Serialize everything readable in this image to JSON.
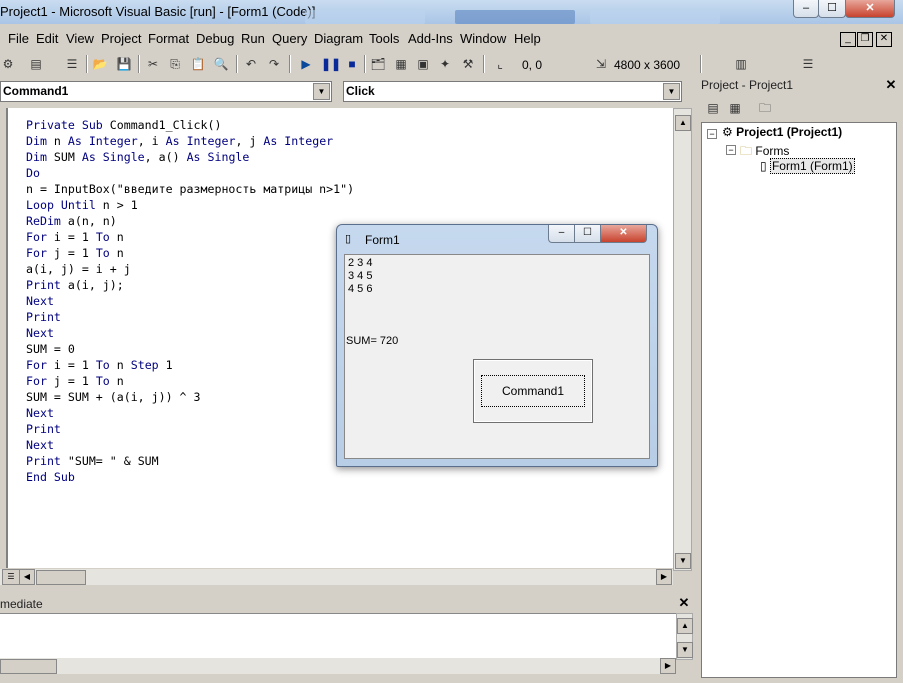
{
  "window": {
    "title": "Project1 - Microsoft Visual Basic [run] - [Form1 (Code)]",
    "controls": {
      "minimize": "–",
      "maximize": "☐",
      "close": "✕"
    }
  },
  "menu": {
    "items": [
      "File",
      "Edit",
      "View",
      "Project",
      "Format",
      "Debug",
      "Run",
      "Query",
      "Diagram",
      "Tools",
      "Add-Ins",
      "Window",
      "Help"
    ],
    "mdi": {
      "minimize": "_",
      "restore": "❐",
      "close": "✕"
    }
  },
  "toolbar": {
    "position": "0, 0",
    "size": "4800 x 3600"
  },
  "code_window": {
    "object_combo": "Command1",
    "procedure_combo": "Click",
    "lines": [
      [
        {
          "k": true,
          "t": "Private Sub "
        },
        {
          "k": false,
          "t": "Command1_Click()"
        }
      ],
      [
        {
          "k": true,
          "t": "Dim "
        },
        {
          "k": false,
          "t": "n "
        },
        {
          "k": true,
          "t": "As Integer"
        },
        {
          "k": false,
          "t": ", i "
        },
        {
          "k": true,
          "t": "As Integer"
        },
        {
          "k": false,
          "t": ", j "
        },
        {
          "k": true,
          "t": "As Integer"
        }
      ],
      [
        {
          "k": true,
          "t": "Dim "
        },
        {
          "k": false,
          "t": "SUM "
        },
        {
          "k": true,
          "t": "As Single"
        },
        {
          "k": false,
          "t": ", a() "
        },
        {
          "k": true,
          "t": "As Single"
        }
      ],
      [
        {
          "k": true,
          "t": "Do"
        }
      ],
      [
        {
          "k": false,
          "t": "n = InputBox(\"введите размерность матрицы n>1\")"
        }
      ],
      [
        {
          "k": true,
          "t": "Loop Until "
        },
        {
          "k": false,
          "t": "n > 1"
        }
      ],
      [
        {
          "k": true,
          "t": "ReDim "
        },
        {
          "k": false,
          "t": "a(n, n)"
        }
      ],
      [
        {
          "k": true,
          "t": "For "
        },
        {
          "k": false,
          "t": "i = 1 "
        },
        {
          "k": true,
          "t": "To "
        },
        {
          "k": false,
          "t": "n"
        }
      ],
      [
        {
          "k": true,
          "t": "For "
        },
        {
          "k": false,
          "t": "j = 1 "
        },
        {
          "k": true,
          "t": "To "
        },
        {
          "k": false,
          "t": "n"
        }
      ],
      [
        {
          "k": false,
          "t": "a(i, j) = i + j"
        }
      ],
      [
        {
          "k": true,
          "t": "Print "
        },
        {
          "k": false,
          "t": "a(i, j);"
        }
      ],
      [
        {
          "k": true,
          "t": "Next"
        }
      ],
      [
        {
          "k": true,
          "t": "Print"
        }
      ],
      [
        {
          "k": true,
          "t": "Next"
        }
      ],
      [
        {
          "k": false,
          "t": "SUM = 0"
        }
      ],
      [
        {
          "k": true,
          "t": "For "
        },
        {
          "k": false,
          "t": "i = 1 "
        },
        {
          "k": true,
          "t": "To "
        },
        {
          "k": false,
          "t": "n "
        },
        {
          "k": true,
          "t": "Step "
        },
        {
          "k": false,
          "t": "1"
        }
      ],
      [
        {
          "k": true,
          "t": "For "
        },
        {
          "k": false,
          "t": "j = 1 "
        },
        {
          "k": true,
          "t": "To "
        },
        {
          "k": false,
          "t": "n"
        }
      ],
      [
        {
          "k": false,
          "t": "SUM = SUM + (a(i, j)) ^ 3"
        }
      ],
      [
        {
          "k": true,
          "t": "Next"
        }
      ],
      [
        {
          "k": true,
          "t": "Print"
        }
      ],
      [
        {
          "k": true,
          "t": "Next"
        }
      ],
      [
        {
          "k": true,
          "t": "Print "
        },
        {
          "k": false,
          "t": "\"SUM= \" & SUM"
        }
      ],
      [
        {
          "k": true,
          "t": "End Sub"
        }
      ]
    ]
  },
  "project_panel": {
    "title": "Project - Project1",
    "close": "✕",
    "tree": {
      "root": "Project1 (Project1)",
      "folder": "Forms",
      "item": "Form1 (Form1)"
    }
  },
  "immediate": {
    "title": "mediate",
    "close": "✕"
  },
  "form1": {
    "title": "Form1",
    "output_lines": [
      "2 3 4",
      "3 4 5",
      "4 5 6"
    ],
    "sum_text": "SUM= 720",
    "button_label": "Command1"
  },
  "colors": {
    "keyword": "#00007f",
    "code_bg": "#ffffff",
    "chrome": "#d4d0c8"
  }
}
